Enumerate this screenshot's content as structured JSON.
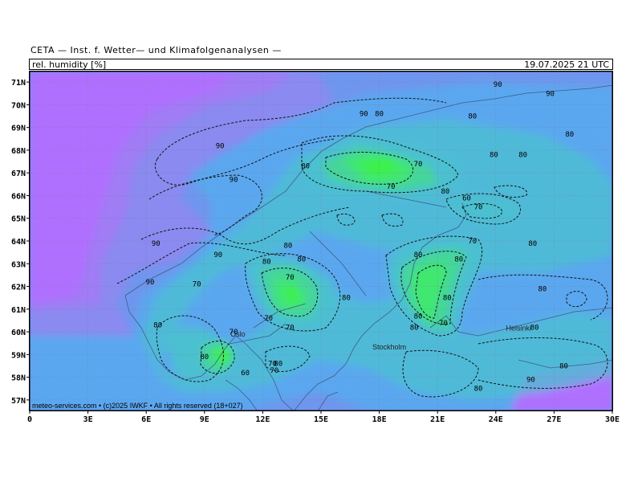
{
  "header": {
    "title": "CETA — Inst. f. Wetter— und Klimafolgenanalysen —",
    "parameter": "rel. humidity [%]",
    "datetime": "19.07.2025 21 UTC"
  },
  "credit": "meteo-services.com • (c)2025 IWKF • All rights reserved (18+027)",
  "axes": {
    "lat_labels": [
      "71N",
      "70N",
      "69N",
      "68N",
      "67N",
      "66N",
      "65N",
      "64N",
      "63N",
      "62N",
      "61N",
      "60N",
      "59N",
      "58N",
      "57N"
    ],
    "lon_labels": [
      "0",
      "3E",
      "6E",
      "9E",
      "12E",
      "15E",
      "18E",
      "21E",
      "24E",
      "27E",
      "30E"
    ]
  },
  "cities": [
    {
      "name": "Oslo",
      "lon": 10.75,
      "lat": 59.9
    },
    {
      "name": "Stockholm",
      "lon": 18.06,
      "lat": 59.33
    },
    {
      "name": "Helsinki",
      "lon": 24.94,
      "lat": 60.17
    }
  ],
  "contour_labels": [
    {
      "text": "90",
      "lon": 24.1,
      "lat": 70.9
    },
    {
      "text": "90",
      "lon": 26.8,
      "lat": 70.5
    },
    {
      "text": "90",
      "lon": 17.2,
      "lat": 69.6
    },
    {
      "text": "80",
      "lon": 18.0,
      "lat": 69.6
    },
    {
      "text": "80",
      "lon": 22.8,
      "lat": 69.5
    },
    {
      "text": "80",
      "lon": 27.8,
      "lat": 68.7
    },
    {
      "text": "90",
      "lon": 9.8,
      "lat": 68.2
    },
    {
      "text": "80",
      "lon": 23.9,
      "lat": 67.8
    },
    {
      "text": "80",
      "lon": 25.4,
      "lat": 67.8
    },
    {
      "text": "80",
      "lon": 14.2,
      "lat": 67.3
    },
    {
      "text": "70",
      "lon": 20.0,
      "lat": 67.4
    },
    {
      "text": "90",
      "lon": 10.5,
      "lat": 66.7
    },
    {
      "text": "70",
      "lon": 18.6,
      "lat": 66.4
    },
    {
      "text": "80",
      "lon": 21.4,
      "lat": 66.2
    },
    {
      "text": "60",
      "lon": 22.5,
      "lat": 65.9
    },
    {
      "text": "70",
      "lon": 23.1,
      "lat": 65.5
    },
    {
      "text": "90",
      "lon": 6.5,
      "lat": 63.9
    },
    {
      "text": "80",
      "lon": 13.3,
      "lat": 63.8
    },
    {
      "text": "70",
      "lon": 22.8,
      "lat": 64.0
    },
    {
      "text": "80",
      "lon": 25.9,
      "lat": 63.9
    },
    {
      "text": "90",
      "lon": 9.7,
      "lat": 63.4
    },
    {
      "text": "80",
      "lon": 20.0,
      "lat": 63.4
    },
    {
      "text": "80",
      "lon": 12.2,
      "lat": 63.1
    },
    {
      "text": "80",
      "lon": 14.0,
      "lat": 63.2
    },
    {
      "text": "80",
      "lon": 22.1,
      "lat": 63.2
    },
    {
      "text": "90",
      "lon": 6.2,
      "lat": 62.2
    },
    {
      "text": "70",
      "lon": 8.6,
      "lat": 62.1
    },
    {
      "text": "70",
      "lon": 13.4,
      "lat": 62.4
    },
    {
      "text": "80",
      "lon": 26.4,
      "lat": 61.9
    },
    {
      "text": "80",
      "lon": 16.3,
      "lat": 61.5
    },
    {
      "text": "80",
      "lon": 21.5,
      "lat": 61.5
    },
    {
      "text": "70",
      "lon": 12.3,
      "lat": 60.6
    },
    {
      "text": "80",
      "lon": 20.0,
      "lat": 60.7
    },
    {
      "text": "80",
      "lon": 6.6,
      "lat": 60.3
    },
    {
      "text": "70",
      "lon": 13.4,
      "lat": 60.2
    },
    {
      "text": "80",
      "lon": 19.8,
      "lat": 60.2
    },
    {
      "text": "70",
      "lon": 21.3,
      "lat": 60.4
    },
    {
      "text": "80",
      "lon": 26.0,
      "lat": 60.2
    },
    {
      "text": "70",
      "lon": 10.5,
      "lat": 60.0
    },
    {
      "text": "80",
      "lon": 9.0,
      "lat": 58.9
    },
    {
      "text": "70",
      "lon": 12.5,
      "lat": 58.6
    },
    {
      "text": "80",
      "lon": 12.8,
      "lat": 58.6
    },
    {
      "text": "60",
      "lon": 11.1,
      "lat": 58.2
    },
    {
      "text": "70",
      "lon": 12.6,
      "lat": 58.3
    },
    {
      "text": "80",
      "lon": 27.5,
      "lat": 58.5
    },
    {
      "text": "90",
      "lon": 25.8,
      "lat": 57.9
    },
    {
      "text": "80",
      "lon": 23.1,
      "lat": 57.5
    }
  ],
  "palette": {
    "v100": "#b070ff",
    "v95": "#a07cf5",
    "v90": "#8a8af0",
    "v85": "#6f96ee",
    "v80": "#5aa7ef",
    "v75": "#4cc0d0",
    "v70": "#45d69a",
    "v65": "#3fe870",
    "v60": "#3df246",
    "contour": "#111111",
    "coast": "#3d5d8a"
  }
}
